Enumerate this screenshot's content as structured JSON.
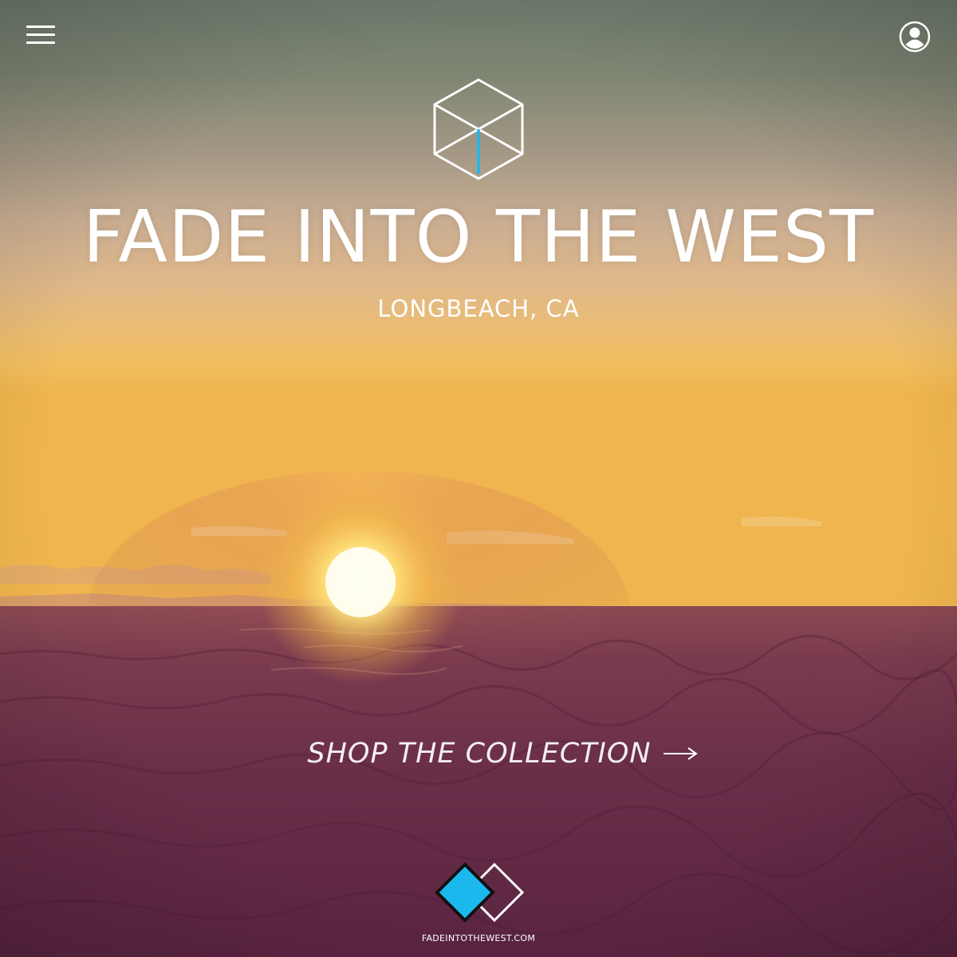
{
  "header": {
    "menu_icon": "hamburger-menu-icon",
    "account_icon": "user-account-icon"
  },
  "hero": {
    "logo_icon": "wireframe-cube-icon",
    "title": "FADE INTO THE WEST",
    "location": "LONGBEACH, CA",
    "cta_label": "SHOP THE COLLECTION",
    "cta_icon": "long-arrow-right-icon"
  },
  "footer": {
    "logo_icon": "double-diamond-icon",
    "url": "FADEINTOTHEWEST.COM"
  },
  "colors": {
    "accent": "#1bb8ee",
    "sky_top": "#6f7b6e",
    "sky_mid": "#cfb08c",
    "sunset_glow": "#f3b44a",
    "sea": "#6a2d48"
  }
}
